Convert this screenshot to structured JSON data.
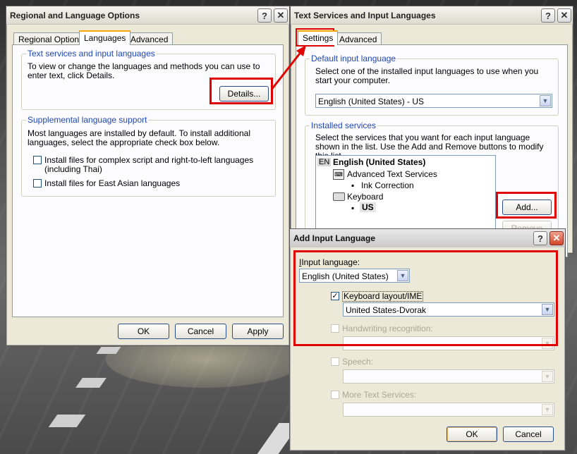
{
  "win1": {
    "title": "Regional and Language Options",
    "tabs": [
      "Regional Options",
      "Languages",
      "Advanced"
    ],
    "group1_title": "Text services and input languages",
    "group1_text": "To view or change the languages and methods you can use to enter text, click Details.",
    "details_button": "Details...",
    "group2_title": "Supplemental language support",
    "group2_text": "Most languages are installed by default. To install additional languages, select the appropriate check box below.",
    "check1": "Install files for complex script and right-to-left languages (including Thai)",
    "check2": "Install files for East Asian languages",
    "ok": "OK",
    "cancel": "Cancel",
    "apply": "Apply"
  },
  "win2": {
    "title": "Text Services and Input Languages",
    "tabs": [
      "Settings",
      "Advanced"
    ],
    "default_group_title": "Default input language",
    "default_text": "Select one of the installed input languages to use when you start your computer.",
    "default_value": "English (United States) - US",
    "installed_group_title": "Installed services",
    "installed_text": "Select the services that you want for each input language shown in the list. Use the Add and Remove buttons to modify this list.",
    "tree": {
      "lang_badge": "EN",
      "lang": "English (United States)",
      "ats": "Advanced Text Services",
      "ink": "Ink Correction",
      "keyboard": "Keyboard",
      "us": "US"
    },
    "add": "Add...",
    "remove": "Remove"
  },
  "win3": {
    "title": "Add Input Language",
    "input_language_label": "Input language:",
    "input_language_value": "English (United States)",
    "keyboard_label": "Keyboard layout/IME",
    "keyboard_checked": true,
    "keyboard_value": "United States-Dvorak",
    "handwriting_label": "Handwriting recognition:",
    "speech_label": "Speech:",
    "more_label": "More Text Services:",
    "ok": "OK",
    "cancel": "Cancel"
  },
  "icons": [
    "help-icon",
    "close-icon",
    "dropdown-arrow-icon",
    "checkmark-icon",
    "keyboard-icon",
    "ats-icon",
    "red-arrow-icon"
  ],
  "colors": {
    "highlight": "#e00000",
    "group_title": "#1f47b5",
    "dialog_bg": "#ece9d8"
  }
}
